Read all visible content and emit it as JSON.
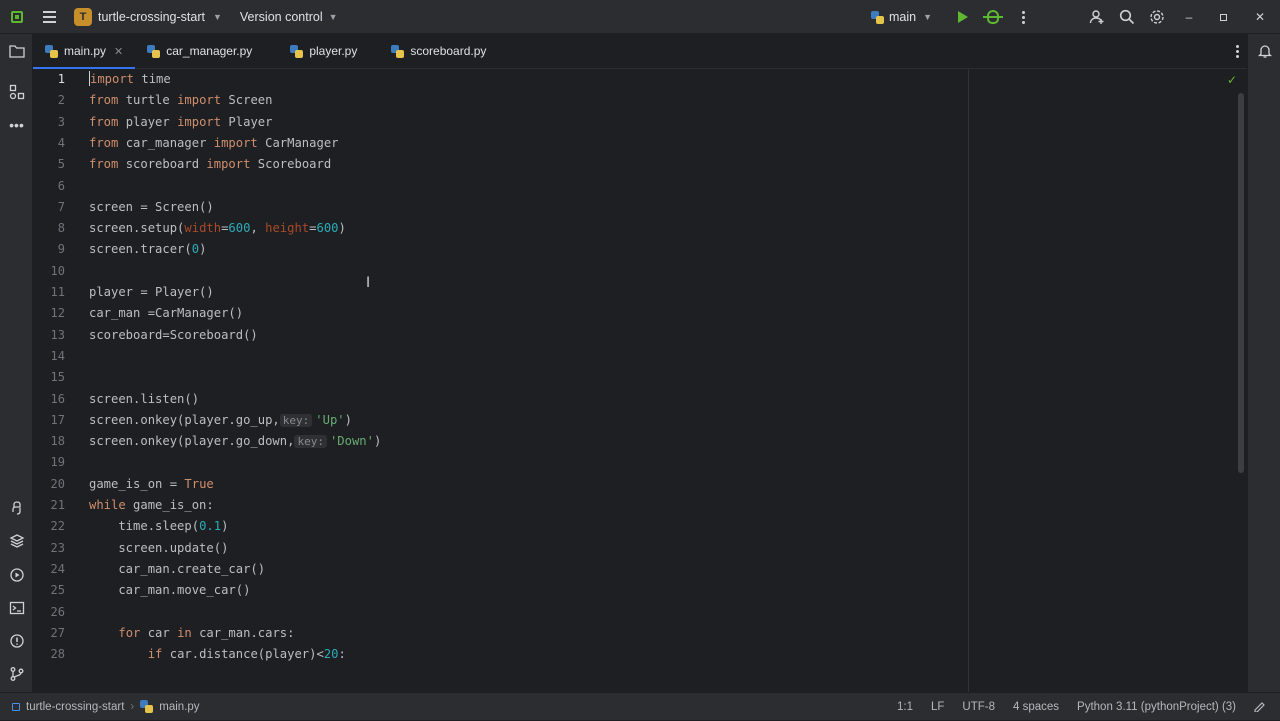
{
  "titlebar": {
    "project_badge": "T",
    "project_name": "turtle-crossing-start",
    "version_control": "Version control",
    "run_config": "main"
  },
  "tabs": [
    {
      "label": "main.py",
      "active": true
    },
    {
      "label": "car_manager.py"
    },
    {
      "label": "player.py"
    },
    {
      "label": "scoreboard.py"
    }
  ],
  "editor": {
    "current_line": 1,
    "line_numbers": [
      "1",
      "2",
      "3",
      "4",
      "5",
      "6",
      "7",
      "8",
      "9",
      "10",
      "11",
      "12",
      "13",
      "14",
      "15",
      "16",
      "17",
      "18",
      "19",
      "20",
      "21",
      "22",
      "23",
      "24",
      "25",
      "26",
      "27",
      "28"
    ],
    "code": {
      "l1": [
        "import",
        " time"
      ],
      "l2": [
        "from",
        " turtle ",
        "import",
        " Screen"
      ],
      "l3": [
        "from",
        " player ",
        "import",
        " Player"
      ],
      "l4": [
        "from",
        " car_manager ",
        "import",
        " CarManager"
      ],
      "l5": [
        "from",
        " scoreboard ",
        "import",
        " Scoreboard"
      ],
      "l7": "screen = Screen()",
      "l8": [
        "screen.setup(",
        "width",
        "=",
        "600",
        ", ",
        "height",
        "=",
        "600",
        ")"
      ],
      "l9": [
        "screen.tracer(",
        "0",
        ")"
      ],
      "l11": "player = Player()",
      "l12": "car_man =CarManager()",
      "l13": "scoreboard=Scoreboard()",
      "l16": "screen.listen()",
      "l17": [
        "screen.onkey(player.go_up,",
        "key:",
        "'Up'",
        ")"
      ],
      "l18": [
        "screen.onkey(player.go_down,",
        "key:",
        "'Down'",
        ")"
      ],
      "l20": [
        "game_is_on = ",
        "True"
      ],
      "l21": [
        "while",
        " game_is_on:"
      ],
      "l22": [
        "    time.sleep(",
        "0.1",
        ")"
      ],
      "l23": "    screen.update()",
      "l24": "    car_man.create_car()",
      "l25": "    car_man.move_car()",
      "l27": [
        "    ",
        "for",
        " car ",
        "in",
        " car_man.cars:"
      ],
      "l28": [
        "        ",
        "if",
        " car.distance(player)<",
        "20",
        ":"
      ]
    }
  },
  "statusbar": {
    "project": "turtle-crossing-start",
    "file": "main.py",
    "position": "1:1",
    "line_sep": "LF",
    "encoding": "UTF-8",
    "indent": "4 spaces",
    "interpreter": "Python 3.11 (pythonProject) (3)"
  },
  "icons": {
    "app": "app-logo-icon",
    "menu": "hamburger-menu-icon",
    "run": "run-icon",
    "debug": "debug-icon",
    "more": "more-vertical-icon",
    "account": "add-user-icon",
    "search": "search-icon",
    "settings": "gear-icon",
    "notifications": "bell-icon"
  },
  "colors": {
    "accent": "#3574f0",
    "keyword": "#cf8e6d",
    "number": "#2aacb8",
    "string": "#6aab73",
    "param": "#aa4926"
  }
}
